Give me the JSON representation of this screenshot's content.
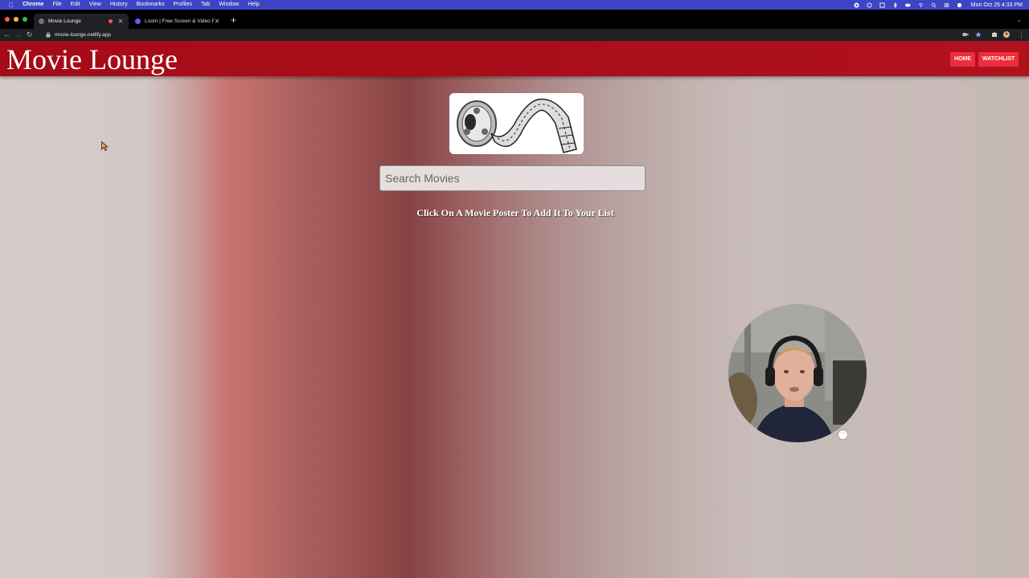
{
  "menubar": {
    "app_name": "Chrome",
    "items": [
      "File",
      "Edit",
      "View",
      "History",
      "Bookmarks",
      "Profiles",
      "Tab",
      "Window",
      "Help"
    ],
    "clock": "Mon Oct 25  4:33 PM"
  },
  "browser": {
    "tabs": [
      {
        "title": "Movie Lounge",
        "active": true
      },
      {
        "title": "Loom | Free Screen & Video Re",
        "active": false
      }
    ],
    "url": "movie-lounge.netlify.app"
  },
  "site": {
    "title": "Movie Lounge",
    "nav": {
      "home": "HOME",
      "watchlist": "WATCHLIST"
    },
    "search_placeholder": "Search Movies",
    "hint": "Click On A Movie Poster To Add It To Your List"
  },
  "colors": {
    "header": "#a80e1a",
    "nav_button": "#ee2e3a",
    "menubar": "#3e44c4"
  },
  "icons": {
    "logo": "film-reel-logo",
    "webcam": "loom-webcam-bubble"
  }
}
